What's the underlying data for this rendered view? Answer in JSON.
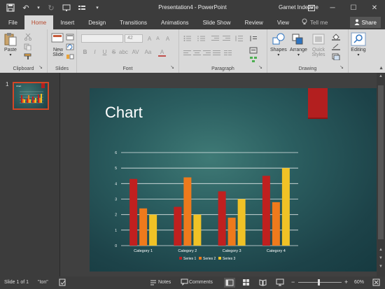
{
  "window": {
    "title": "Presentation4 - PowerPoint",
    "user": "Garnet Indezine"
  },
  "tabs": [
    {
      "label": "File"
    },
    {
      "label": "Home"
    },
    {
      "label": "Insert"
    },
    {
      "label": "Design"
    },
    {
      "label": "Transitions"
    },
    {
      "label": "Animations"
    },
    {
      "label": "Slide Show"
    },
    {
      "label": "Review"
    },
    {
      "label": "View"
    }
  ],
  "tell_me": "Tell me",
  "share": "Share",
  "ribbon": {
    "clipboard": {
      "label": "Clipboard",
      "paste": "Paste"
    },
    "slides": {
      "label": "Slides",
      "new_slide_line1": "New",
      "new_slide_line2": "Slide"
    },
    "font": {
      "label": "Font",
      "size": "42"
    },
    "paragraph": {
      "label": "Paragraph"
    },
    "drawing": {
      "label": "Drawing",
      "shapes": "Shapes",
      "arrange": "Arrange",
      "quick_styles_line1": "Quick",
      "quick_styles_line2": "Styles"
    },
    "editing": {
      "label": "Editing"
    }
  },
  "thumbnails": {
    "slide_number": "1",
    "thumb_title": "Chart"
  },
  "slide": {
    "title": "Chart"
  },
  "chart_data": {
    "type": "bar",
    "categories": [
      "Category 1",
      "Category 2",
      "Category 3",
      "Category 4"
    ],
    "series": [
      {
        "name": "Series 1",
        "values": [
          4.3,
          2.5,
          3.5,
          4.5
        ]
      },
      {
        "name": "Series 2",
        "values": [
          2.4,
          4.4,
          1.8,
          2.8
        ]
      },
      {
        "name": "Series 3",
        "values": [
          2,
          2,
          3,
          5
        ]
      }
    ],
    "ylim": [
      0,
      6
    ],
    "yticks": [
      "0",
      "1",
      "2",
      "3",
      "4",
      "5",
      "6"
    ],
    "grid": true,
    "legend": "bottom",
    "colors": [
      "#c0201f",
      "#ee7a1c",
      "#f0c226"
    ]
  },
  "status": {
    "slide_info": "Slide 1 of 1",
    "theme": "\"Ion\"",
    "notes": "Notes",
    "comments": "Comments",
    "zoom": "60%"
  }
}
